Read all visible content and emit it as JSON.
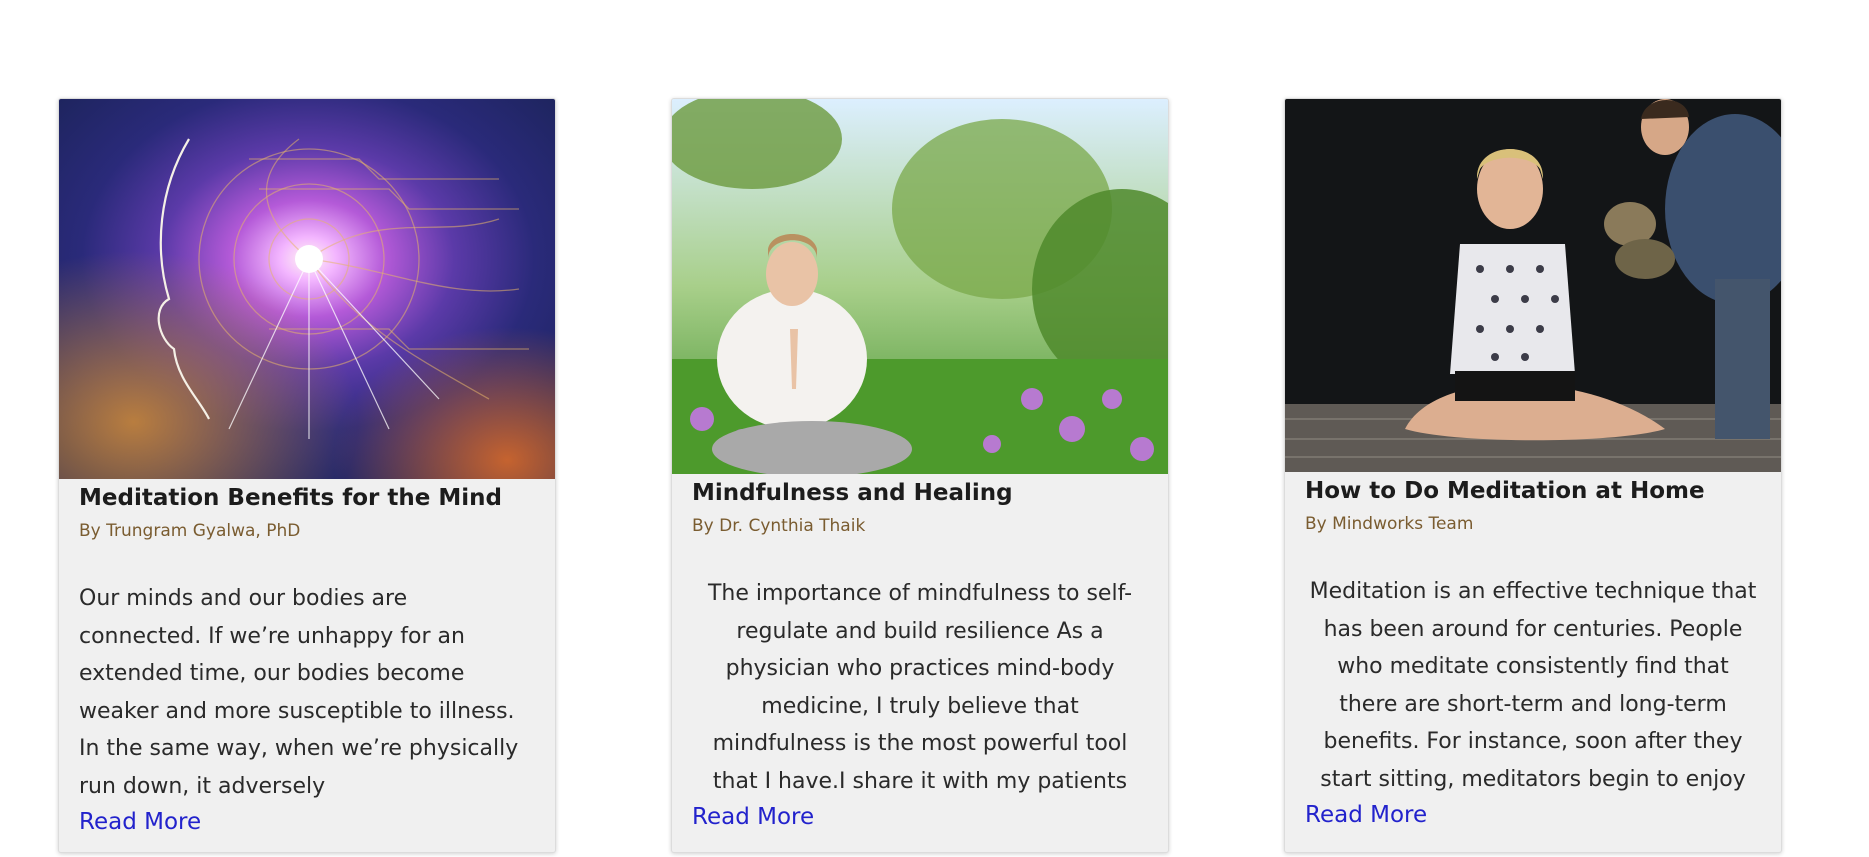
{
  "cards": [
    {
      "title": "Meditation Benefits for the Mind",
      "author": "By Trungram Gyalwa, PhD",
      "excerpt": "Our minds and our bodies are connected. If we’re unhappy for an extended time, our bodies become weaker and more susceptible to illness. In the same way, when we’re physically run down, it adversely",
      "link_label": "Read More",
      "image": "cosmic-mind-spiral-image"
    },
    {
      "title": "Mindfulness and Healing",
      "author": "By Dr. Cynthia Thaik",
      "excerpt": "The importance of mindfulness to self-regulate and build resilience As a physician who practices mind-body medicine, I truly believe that mindfulness is the most powerful tool that I have.I share it with my patients",
      "link_label": "Read More",
      "image": "woman-meditating-in-meadow-image"
    },
    {
      "title": "How to Do Meditation at Home",
      "author": "By Mindworks Team",
      "excerpt": "Meditation is an effective technique that has been around for centuries. People who meditate consistently find that there are short-term and long-term benefits. For instance, soon after they start sitting, meditators begin to enjoy",
      "link_label": "Read More",
      "image": "pregnant-woman-meditating-at-home-image"
    }
  ],
  "colors": {
    "card_background": "#f0f0f0",
    "title": "#1c1c1c",
    "author": "#7a5c30",
    "text": "#2a2a2a",
    "link": "#2222cc"
  }
}
